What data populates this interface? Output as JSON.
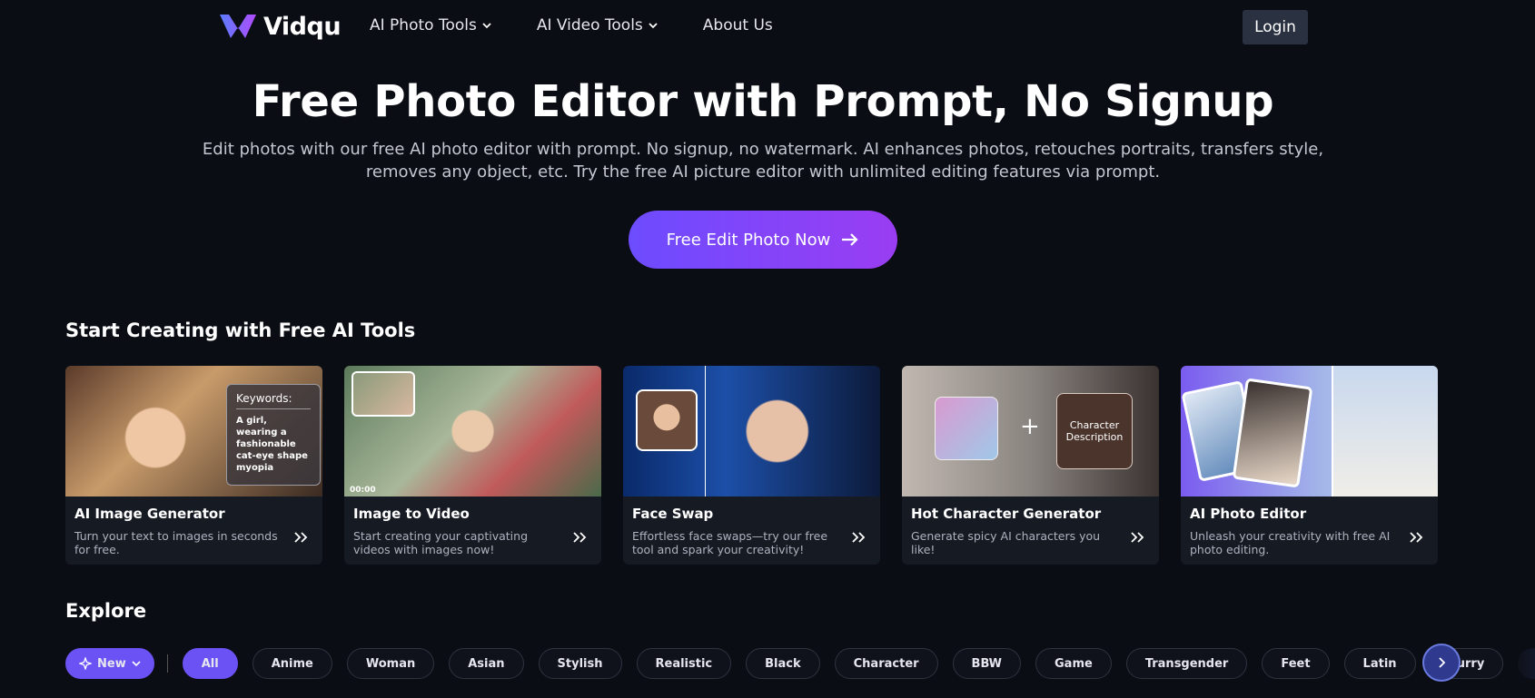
{
  "nav": {
    "logo_text": "Vidqu",
    "links": [
      "AI Photo Tools",
      "AI Video Tools",
      "About Us"
    ],
    "login": "Login"
  },
  "hero": {
    "title": "Free Photo Editor with Prompt, No Signup",
    "subtitle": "Edit photos with our free AI photo editor with prompt. No signup, no watermark. AI enhances photos, retouches portraits, transfers style, removes any object, etc. Try the free AI picture editor with unlimited editing features via prompt.",
    "cta": "Free Edit Photo Now"
  },
  "tools": {
    "heading": "Start Creating with Free AI Tools",
    "cards": [
      {
        "title": "AI Image Generator",
        "desc": "Turn your text to images in seconds for free."
      },
      {
        "title": "Image to Video",
        "desc": "Start creating your captivating videos with images now!"
      },
      {
        "title": "Face Swap",
        "desc": "Effortless face swaps—try our free tool and spark your creativity!"
      },
      {
        "title": "Hot Character Generator",
        "desc": "Generate spicy AI characters you like!"
      },
      {
        "title": "AI Photo Editor",
        "desc": "Unleash your creativity with free AI photo editing."
      }
    ],
    "keywords_label": "Keywords:",
    "keywords_text": "A girl, wearing a fashionable cat-eye shape myopia",
    "video_time": "00:00",
    "character_box": "Character Description"
  },
  "explore": {
    "heading": "Explore",
    "new_label": "New",
    "chips": [
      "All",
      "Anime",
      "Woman",
      "Asian",
      "Stylish",
      "Realistic",
      "Black",
      "Character",
      "BBW",
      "Game",
      "Transgender",
      "Feet",
      "Latin",
      "Furry"
    ]
  },
  "colors": {
    "background": "#0b0d14",
    "accent": "#6a52f5",
    "cta_gradient_start": "#6d4cff",
    "cta_gradient_end": "#9a3df2"
  }
}
